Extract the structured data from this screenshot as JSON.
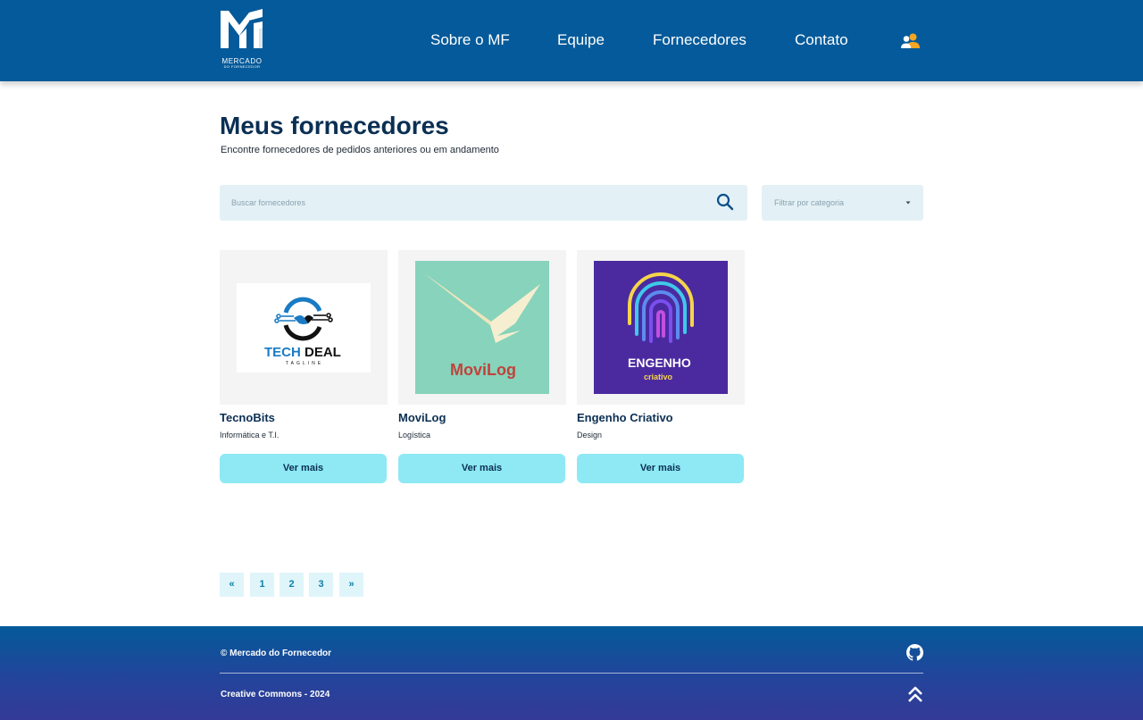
{
  "header": {
    "logo_text": "MERCADO",
    "logo_subtext": "DO FORNECEDOR",
    "nav": [
      {
        "label": "Sobre o MF"
      },
      {
        "label": "Equipe"
      },
      {
        "label": "Fornecedores"
      },
      {
        "label": "Contato"
      }
    ],
    "user_icon": "users-icon"
  },
  "main": {
    "title": "Meus fornecedores",
    "subtitle": "Encontre fornecedores de pedidos anteriores ou em andamento",
    "search": {
      "placeholder": "Buscar fornecedores",
      "value": "",
      "icon": "search-icon"
    },
    "filter": {
      "label": "Filtrar por categoria",
      "icon": "caret-down-icon"
    },
    "cards": [
      {
        "name": "TecnoBits",
        "category": "Informática e T.I.",
        "button": "Ver mais",
        "logo": {
          "line1": "TECH DEAL",
          "line2": "TAGLINE"
        }
      },
      {
        "name": "MoviLog",
        "category": "Logística",
        "button": "Ver mais",
        "logo": {
          "line1": "MoviLog",
          "bg": "#87d3bb",
          "text_color": "#c0433b"
        }
      },
      {
        "name": "Engenho Criativo",
        "category": "Design",
        "button": "Ver mais",
        "logo": {
          "line1": "ENGENHO",
          "line2": "criativo",
          "bg": "#4b2aa0",
          "accent": "#f5d54a"
        }
      }
    ]
  },
  "pagination": {
    "prev": "«",
    "pages": [
      "1",
      "2",
      "3"
    ],
    "next": "»"
  },
  "footer": {
    "copyright": "© Mercado do Fornecedor",
    "license": "Creative Commons - 2024",
    "github_icon": "github-icon",
    "top_icon": "double-chevron-up-icon"
  },
  "colors": {
    "header_bg": "#045a9a",
    "title": "#0b2f53",
    "button": "#8ee9f4",
    "input_bg": "#e3f1f6"
  }
}
